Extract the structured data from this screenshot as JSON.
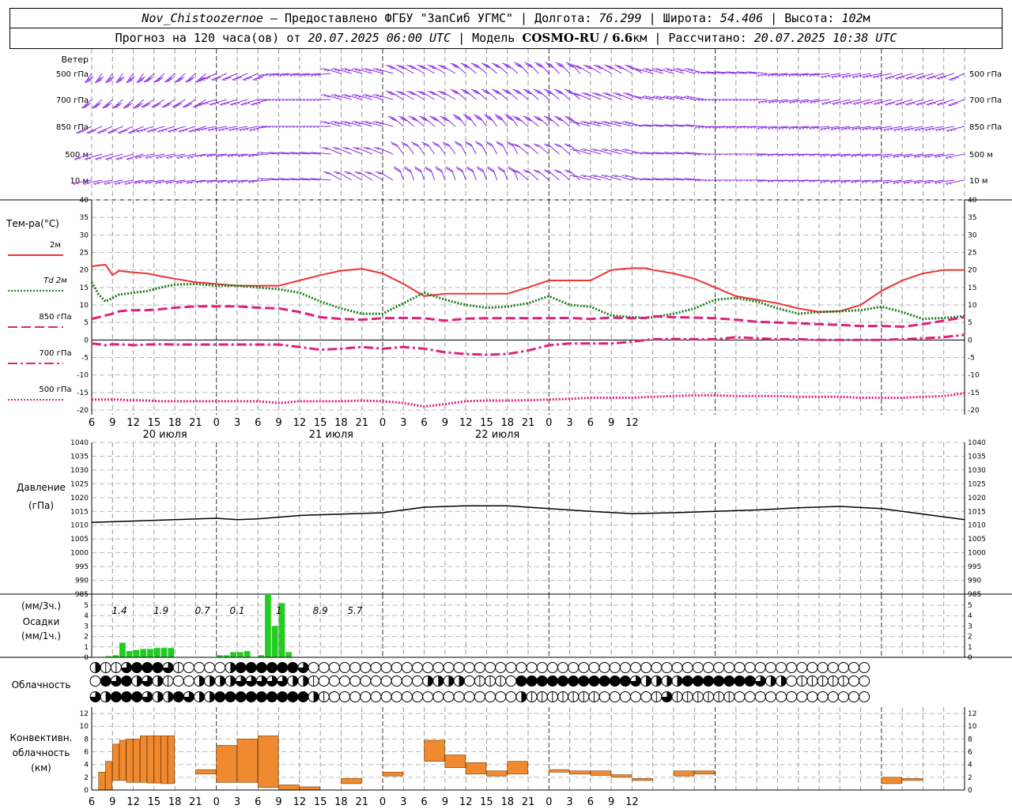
{
  "header": {
    "station": "Nov_Chistoozernoe",
    "dash": " — ",
    "provider": "Предоставлено ФГБУ \"ЗапСиб УГМС\"",
    "lon_label": "Долгота:",
    "lon_value": "76.299",
    "lat_label": "Широта:",
    "lat_value": "54.406",
    "alt_label": "Высота:",
    "alt_value": "102",
    "alt_unit": "м",
    "forecast_label": "Прогноз на 120 часа(ов) от",
    "forecast_start": "20.07.2025 06:00 UTC",
    "model_label": "Модель",
    "model_name": "COSMO-RU / 6.6",
    "model_unit": "км",
    "calc_label": "Рассчитано:",
    "calc_time": "20.07.2025 10:38 UTC"
  },
  "wind_panel": {
    "title": "Ветер",
    "levels": [
      "500 гПа",
      "700 гПа",
      "850 гПа",
      "500 м",
      "10 м"
    ],
    "barb_color": "#8a2be2"
  },
  "temp_panel": {
    "title": "Тем-ра(°С)",
    "legend": [
      {
        "label": "2м",
        "color": "#ee3333",
        "dash": "solid"
      },
      {
        "label": "Td 2м",
        "color": "#1a7a1a",
        "dash": "dot"
      },
      {
        "label": "850 гПа",
        "color": "#e0207a",
        "dash": "dash"
      },
      {
        "label": "700 гПа",
        "color": "#e0207a",
        "dash": "dashdot"
      },
      {
        "label": "500 гПа",
        "color": "#e0207a",
        "dash": "dot"
      }
    ],
    "ylim": [
      -20,
      40
    ],
    "yticks": [
      "40",
      "35",
      "30",
      "25",
      "20",
      "15",
      "10",
      "5",
      "0",
      "-5",
      "-10",
      "-15",
      "-20"
    ]
  },
  "time_axis": {
    "hour_labels": [
      "6",
      "9",
      "12",
      "15",
      "18",
      "21",
      "0",
      "3",
      "6",
      "9",
      "12",
      "15",
      "18",
      "21",
      "0",
      "3",
      "6",
      "9",
      "12",
      "15",
      "18",
      "21",
      "0",
      "3",
      "6",
      "9",
      "12"
    ],
    "day_labels": [
      "20 июля",
      "21 июля",
      "22 июля"
    ]
  },
  "pressure_panel": {
    "title": "Давление",
    "unit": "(гПа)",
    "ylim": [
      985,
      1040
    ],
    "yticks": [
      "1040",
      "1035",
      "1030",
      "1025",
      "1020",
      "1015",
      "1010",
      "1005",
      "1000",
      "995",
      "990",
      "985"
    ],
    "line_color": "#000000"
  },
  "precip_panel": {
    "unit3h": "(мм/3ч.)",
    "title": "Осадки",
    "unit1h": "(мм/1ч.)",
    "ylim": [
      0,
      5
    ],
    "yticks": [
      "5",
      "4",
      "3",
      "2",
      "1",
      "0"
    ],
    "bar_color": "#22cc22",
    "totals": [
      "1.4",
      "1.9",
      "0.7",
      "0.1",
      "1",
      "8.9",
      "5.7"
    ]
  },
  "cloud_panel": {
    "title": "Облачность"
  },
  "conv_panel": {
    "title1": "Конвективн.",
    "title2": "облачность",
    "unit": "(км)",
    "ylim": [
      0,
      13
    ],
    "yticks": [
      "12",
      "10",
      "8",
      "6",
      "4",
      "2",
      "0"
    ],
    "bar_color": "#f08a30"
  },
  "chart_data": [
    {
      "type": "line",
      "title": "Тем-ра(°С)",
      "x_hours": [
        0,
        1,
        2,
        3,
        4,
        5,
        6,
        8,
        10,
        12,
        15,
        18,
        21,
        24,
        27,
        30,
        33,
        36,
        39,
        42,
        45,
        48,
        51,
        54,
        57,
        60,
        63,
        66,
        69,
        72,
        75,
        78,
        80,
        81,
        84,
        87,
        90,
        93,
        96,
        99,
        102,
        105,
        108,
        111,
        114,
        117,
        120,
        123,
        126
      ],
      "ylim": [
        -20,
        40
      ],
      "series": [
        {
          "name": "2м",
          "values": [
            21,
            21.3,
            21.5,
            18.5,
            19.8,
            19.5,
            19.3,
            19,
            18.2,
            17.5,
            16.5,
            16,
            15.5,
            15.5,
            15.5,
            17,
            18.5,
            19.8,
            20.3,
            19,
            16,
            12.5,
            13.2,
            13.2,
            13.2,
            13.2,
            15,
            17,
            17,
            17,
            20,
            20.5,
            20.5,
            20,
            19,
            17.5,
            15,
            12.5,
            11.5,
            10.5,
            9,
            8,
            8.2,
            10,
            14,
            17,
            19,
            20,
            20
          ]
        },
        {
          "name": "Td 2м",
          "values": [
            16.5,
            13,
            11,
            12,
            13,
            13.2,
            13.5,
            14,
            15,
            15.8,
            16,
            15.5,
            15.5,
            15,
            14.5,
            13.5,
            11,
            9,
            7.5,
            7.5,
            10.5,
            13.5,
            11.5,
            10,
            9.2,
            9.5,
            10.5,
            12.5,
            10,
            9.5,
            7,
            6.5,
            6.3,
            6.5,
            7.5,
            9,
            11.5,
            12,
            11,
            9,
            7.5,
            8,
            8.2,
            8.5,
            9.5,
            8,
            6,
            6.3,
            6.8
          ]
        },
        {
          "name": "850 гПа",
          "values": [
            6,
            6.5,
            7,
            7.5,
            8.2,
            8.4,
            8.5,
            8.5,
            8.8,
            9.2,
            9.6,
            9.6,
            9.6,
            9.2,
            9,
            8,
            6.5,
            6,
            5.8,
            6.2,
            6.3,
            6.2,
            5.5,
            6.1,
            6.2,
            6.2,
            6.2,
            6.2,
            6.3,
            6,
            6.4,
            6.2,
            6.3,
            6.8,
            6.5,
            6.4,
            6.2,
            5.8,
            5.2,
            5,
            4.8,
            4.5,
            4.3,
            4,
            4,
            3.8,
            4.5,
            5.5,
            6.5
          ]
        },
        {
          "name": "700 гПа",
          "values": [
            -1,
            -1.2,
            -1.5,
            -1.2,
            -1.3,
            -1.3,
            -1.5,
            -1.3,
            -1.2,
            -1.3,
            -1.3,
            -1.3,
            -1.3,
            -1.3,
            -1.3,
            -2,
            -2.8,
            -2.5,
            -2,
            -2.5,
            -2,
            -2.5,
            -3.5,
            -4,
            -4.2,
            -4,
            -3,
            -1.5,
            -1,
            -1,
            -1,
            -0.5,
            0,
            0.2,
            0.3,
            0.2,
            0.2,
            0.8,
            0.5,
            0.2,
            0.2,
            0,
            0,
            0,
            0,
            0.2,
            0.5,
            0.8,
            1.5
          ]
        },
        {
          "name": "500 гПа",
          "values": [
            -17,
            -17,
            -17,
            -17,
            -17,
            -17.2,
            -17.2,
            -17.3,
            -17.5,
            -17.5,
            -17.5,
            -17.5,
            -17.5,
            -17.5,
            -18,
            -17.5,
            -17.5,
            -17.5,
            -17.3,
            -17.5,
            -18,
            -19,
            -18.3,
            -17.5,
            -17.3,
            -17.3,
            -17.2,
            -17,
            -16.8,
            -16.5,
            -16.5,
            -16.5,
            -16.3,
            -16.2,
            -16,
            -15.8,
            -15.8,
            -16,
            -16,
            -16,
            -16.2,
            -16.2,
            -16.2,
            -16.5,
            -16.5,
            -16.5,
            -16.2,
            -16,
            -15.2
          ]
        }
      ]
    },
    {
      "type": "line",
      "title": "Давление",
      "x_hours": [
        0,
        6,
        12,
        18,
        21,
        24,
        30,
        36,
        42,
        48,
        54,
        60,
        66,
        72,
        78,
        84,
        90,
        96,
        102,
        108,
        114,
        120,
        126
      ],
      "ylim": [
        985,
        1040
      ],
      "series": [
        {
          "name": "Давление",
          "values": [
            1011,
            1011.5,
            1012,
            1012.5,
            1012,
            1012.3,
            1013.5,
            1014,
            1014.5,
            1016.5,
            1017,
            1017,
            1016,
            1015,
            1014.2,
            1014.5,
            1015,
            1015.5,
            1016.3,
            1016.8,
            1016,
            1014,
            1012
          ]
        }
      ]
    },
    {
      "type": "bar",
      "title": "Осадки",
      "x_hours": [
        0,
        1,
        2,
        3,
        4,
        5,
        6,
        7,
        8,
        9,
        10,
        11,
        12,
        13,
        14,
        15,
        16,
        17,
        18,
        19,
        20,
        21,
        22,
        23,
        24,
        25,
        26,
        27,
        28,
        29,
        30,
        31,
        32,
        33,
        34,
        35,
        36
      ],
      "values": [
        0,
        0,
        0.1,
        0.2,
        1.4,
        0.6,
        0.7,
        0.8,
        0.8,
        0.9,
        0.9,
        0.9,
        0,
        0,
        0,
        0,
        0,
        0,
        0.2,
        0.2,
        0.5,
        0.5,
        0.6,
        0,
        0.2,
        6.8,
        3,
        5.2,
        0.5,
        0,
        0,
        0,
        0,
        0,
        0,
        0,
        0
      ],
      "ylim": [
        0,
        5
      ]
    },
    {
      "type": "bar",
      "title": "Конвективн. облачность",
      "x_hours": [
        0,
        1,
        2,
        3,
        4,
        5,
        6,
        7,
        8,
        9,
        10,
        11,
        12,
        15,
        18,
        21,
        24,
        27,
        30,
        33,
        36,
        42,
        45,
        48,
        51,
        54,
        57,
        60,
        63,
        66,
        69,
        72,
        75,
        78,
        81,
        84,
        87,
        90,
        93,
        96,
        99,
        102,
        105,
        108,
        111,
        114,
        117,
        120,
        123,
        126
      ],
      "bases": [
        0,
        0,
        0,
        1.5,
        1.5,
        1.2,
        1.2,
        1.2,
        1.1,
        1.1,
        1,
        1,
        0,
        2.5,
        1.2,
        1.2,
        0.4,
        0,
        0,
        0,
        1,
        2.2,
        0,
        4.5,
        3.5,
        2.5,
        2.2,
        2.5,
        0,
        2.8,
        2.5,
        2.3,
        2,
        1.5,
        0,
        2.2,
        2.5,
        0,
        0,
        0,
        0,
        0,
        0,
        0,
        0,
        1,
        1.5,
        0,
        0,
        0
      ],
      "tops": [
        0,
        2.8,
        4.5,
        7.2,
        7.8,
        8,
        8,
        8.5,
        8.5,
        8.5,
        8.5,
        8.5,
        0,
        3.2,
        7,
        8,
        8.5,
        0.8,
        0.5,
        0,
        1.8,
        2.8,
        0,
        7.8,
        5.5,
        4.3,
        3,
        4.5,
        0,
        3.2,
        3,
        3,
        2.4,
        1.8,
        0,
        3,
        3,
        0,
        0,
        0,
        0,
        0,
        0,
        0,
        0,
        2,
        1.8,
        0,
        0,
        0
      ],
      "ylim": [
        0,
        13
      ]
    }
  ]
}
